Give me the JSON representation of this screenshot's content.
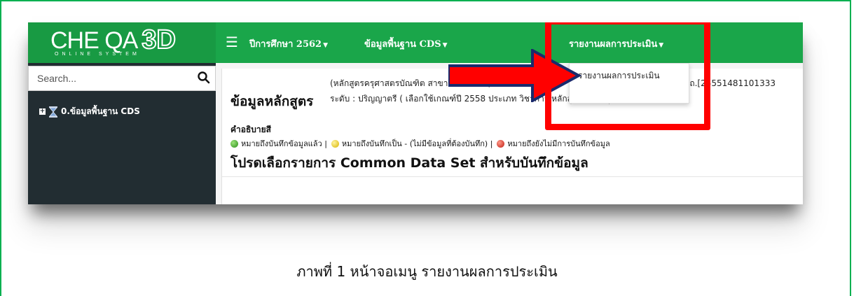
{
  "app": {
    "logo_text": "CHE QA",
    "logo_3d": "3D",
    "logo_subtitle": "ONLINE SYSTEM"
  },
  "navbar": {
    "menu_icon": "hamburger-icon",
    "items": [
      {
        "label": "ปีการศึกษา 2562"
      },
      {
        "label": "ข้อมูลพื้นฐาน CDS"
      },
      {
        "label": "รายงานผลการประเมิน"
      }
    ],
    "color": "#1aa64a"
  },
  "sidebar": {
    "search_placeholder": "Search...",
    "search_icon": "search-icon",
    "tree": [
      {
        "label": "0.ข้อมูลพื้นฐาน CDS",
        "icon": "hourglass-icon"
      }
    ],
    "color": "#222d32"
  },
  "content": {
    "course_title": "ข้อมูลหลักสูตร",
    "course_name": "(หลักสูตรครุศาสตรบัณฑิต สาขาวิชาดนตรี (5",
    "course_code": "สถ.[25551481101333",
    "course_level": "ระดับ : ปริญญาตรี ( เลือกใช้เกณฑ์ปี 2558 ประเภท วิชาการ หลักสูตร ปรับปรุง พ.ศ. 2562 )",
    "legend_title": "คำอธิบายสี",
    "legend": [
      {
        "text": "หมายถึงบันทึกข้อมูลแล้ว |",
        "color": "green"
      },
      {
        "text": "หมายถึงบันทึกเป็น - (ไม่มีข้อมูลที่ต้องบันทึก) |",
        "color": "yellow"
      },
      {
        "text": "หมายถึงยังไม่มีการบันทึกข้อมูล",
        "color": "red"
      }
    ],
    "select_title": "โปรดเลือกรายการ Common Data Set สำหรับบันทึกข้อมูล"
  },
  "dropdown": {
    "items": [
      {
        "label": "รายงานผลการประเมิน"
      }
    ]
  },
  "annotation": {
    "highlight_color": "#ff0000",
    "arrow_color": "#ff0000"
  },
  "caption": "ภาพที่ 1 หน้าจอเมนู รายงานผลการประเมิน"
}
